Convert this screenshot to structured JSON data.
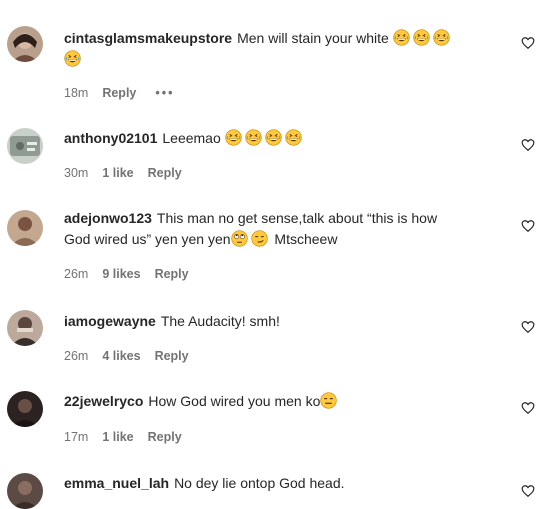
{
  "comments": [
    {
      "username": "cintasglamsmakeupstore",
      "text": "Men will stain your white",
      "emojis_line1": [
        "grinning-sweat",
        "grinning-sweat",
        "grinning-sweat"
      ],
      "emojis_line2": [
        "grinning-sweat"
      ],
      "time": "18m",
      "likes": "",
      "reply": "Reply",
      "more": "•••",
      "avatar_color": "#b9a08c"
    },
    {
      "username": "anthony02101",
      "text": "Leeemao",
      "emojis": [
        "grinning-sweat",
        "grinning-sweat",
        "grinning-sweat",
        "grinning-sweat"
      ],
      "time": "30m",
      "likes": "1 like",
      "reply": "Reply",
      "avatar_color": "#9aa39a"
    },
    {
      "username": "adejonwo123",
      "text_line1": "This man no get sense,talk about “this is how",
      "text_line2": "God wired us” yen yen yen",
      "text_line2_tail": "Mtscheew",
      "emojis": [
        "face-rolling-eyes",
        "smirk"
      ],
      "time": "26m",
      "likes": "9 likes",
      "reply": "Reply",
      "avatar_color": "#8a6a55"
    },
    {
      "username": "iamogewayne",
      "text": "The Audacity! smh!",
      "time": "26m",
      "likes": "4 likes",
      "reply": "Reply",
      "avatar_color": "#6b5a52"
    },
    {
      "username": "22jewelryco",
      "text": "How God wired you men ko",
      "emojis": [
        "expressionless"
      ],
      "time": "17m",
      "likes": "1 like",
      "reply": "Reply",
      "avatar_color": "#3b3330"
    },
    {
      "username": "emma_nuel_lah",
      "text": "No dey lie ontop God head.",
      "avatar_color": "#4a3a35"
    }
  ],
  "colors": {
    "text": "#262626",
    "meta": "#737373",
    "emoji_face": "#ffc83d",
    "emoji_tear": "#4ba3f2"
  },
  "icons": {
    "like": "heart-outline-icon"
  }
}
